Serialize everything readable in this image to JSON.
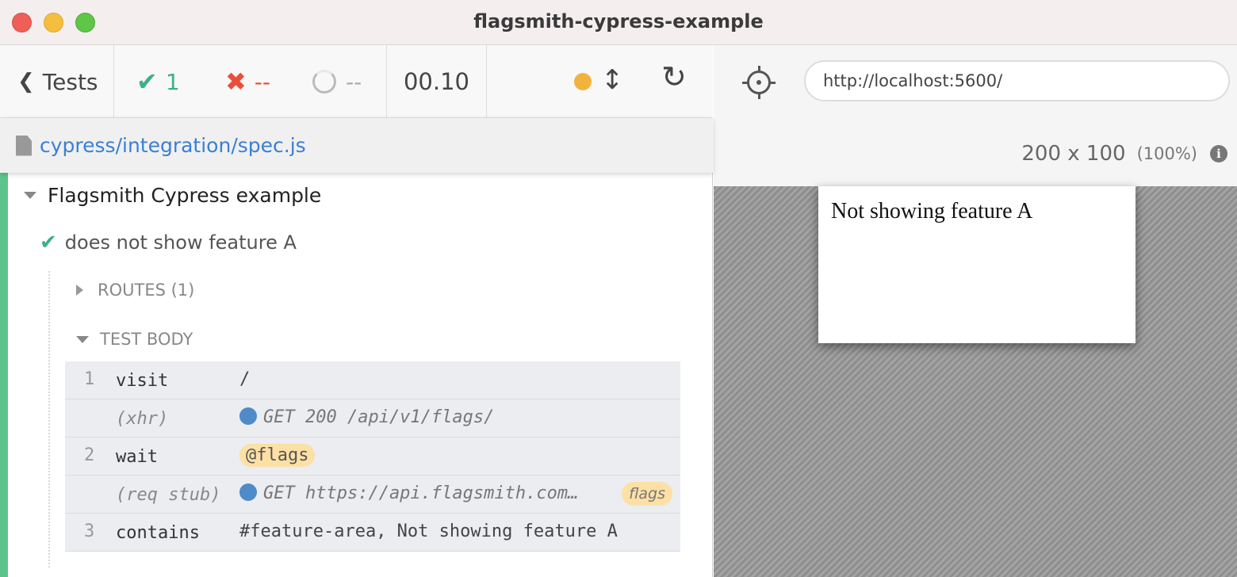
{
  "window": {
    "title": "flagsmith-cypress-example"
  },
  "toolbar": {
    "tests_label": "Tests",
    "passed": "1",
    "failed": "--",
    "pending": "--",
    "duration": "00.10"
  },
  "spec": {
    "path": "cypress/integration/spec.js"
  },
  "suite": {
    "title": "Flagsmith Cypress example"
  },
  "test": {
    "title": "does not show feature A"
  },
  "sections": {
    "routes": "ROUTES (1)",
    "test_body": "TEST BODY"
  },
  "commands": [
    {
      "num": "1",
      "name": "visit",
      "message": "/"
    },
    {
      "num": "",
      "name": "(xhr)",
      "message": "GET 200 /api/v1/flags/"
    },
    {
      "num": "2",
      "name": "wait",
      "message": "@flags"
    },
    {
      "num": "",
      "name": "(req stub)",
      "message": "GET https://api.flagsmith.com…",
      "badge": "flags"
    },
    {
      "num": "3",
      "name": "contains",
      "message": "#feature-area, Not showing feature A"
    }
  ],
  "browser": {
    "url": "http://localhost:5600/",
    "viewport_size": "200 x 100",
    "viewport_scale": "(100%)"
  },
  "app": {
    "text": "Not showing feature A"
  },
  "colors": {
    "pass": "#3eb084",
    "fail": "#e94f3a",
    "link": "#3a7fd5",
    "running_dot": "#f2b33c",
    "xhr_dot": "#4f8ac9",
    "alias_bg": "#fce0a5"
  }
}
